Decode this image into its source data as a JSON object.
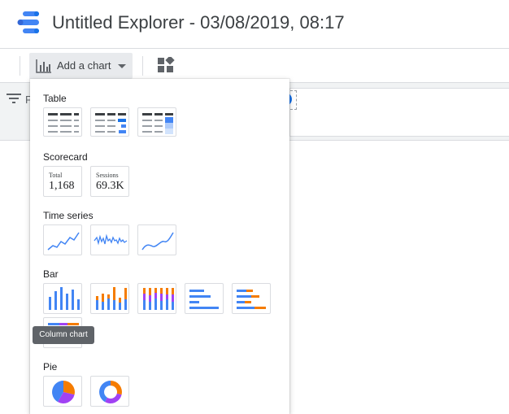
{
  "app": {
    "title": "Untitled Explorer - 03/08/2019, 08:17"
  },
  "toolbar": {
    "add_chart_label": "Add a chart"
  },
  "filterbar": {
    "label_partial": "F"
  },
  "dropdown": {
    "sections": {
      "table": "Table",
      "scorecard": "Scorecard",
      "time_series": "Time series",
      "bar": "Bar",
      "pie": "Pie"
    },
    "scorecards": [
      {
        "label": "Total",
        "value": "1,168"
      },
      {
        "label": "Sessions",
        "value": "69.3K"
      }
    ]
  },
  "tooltip": {
    "text": "Column chart"
  },
  "colors": {
    "blue": "#4285f4",
    "orange": "#f57c00",
    "purple": "#a142f4",
    "accent": "#1a73e8"
  }
}
